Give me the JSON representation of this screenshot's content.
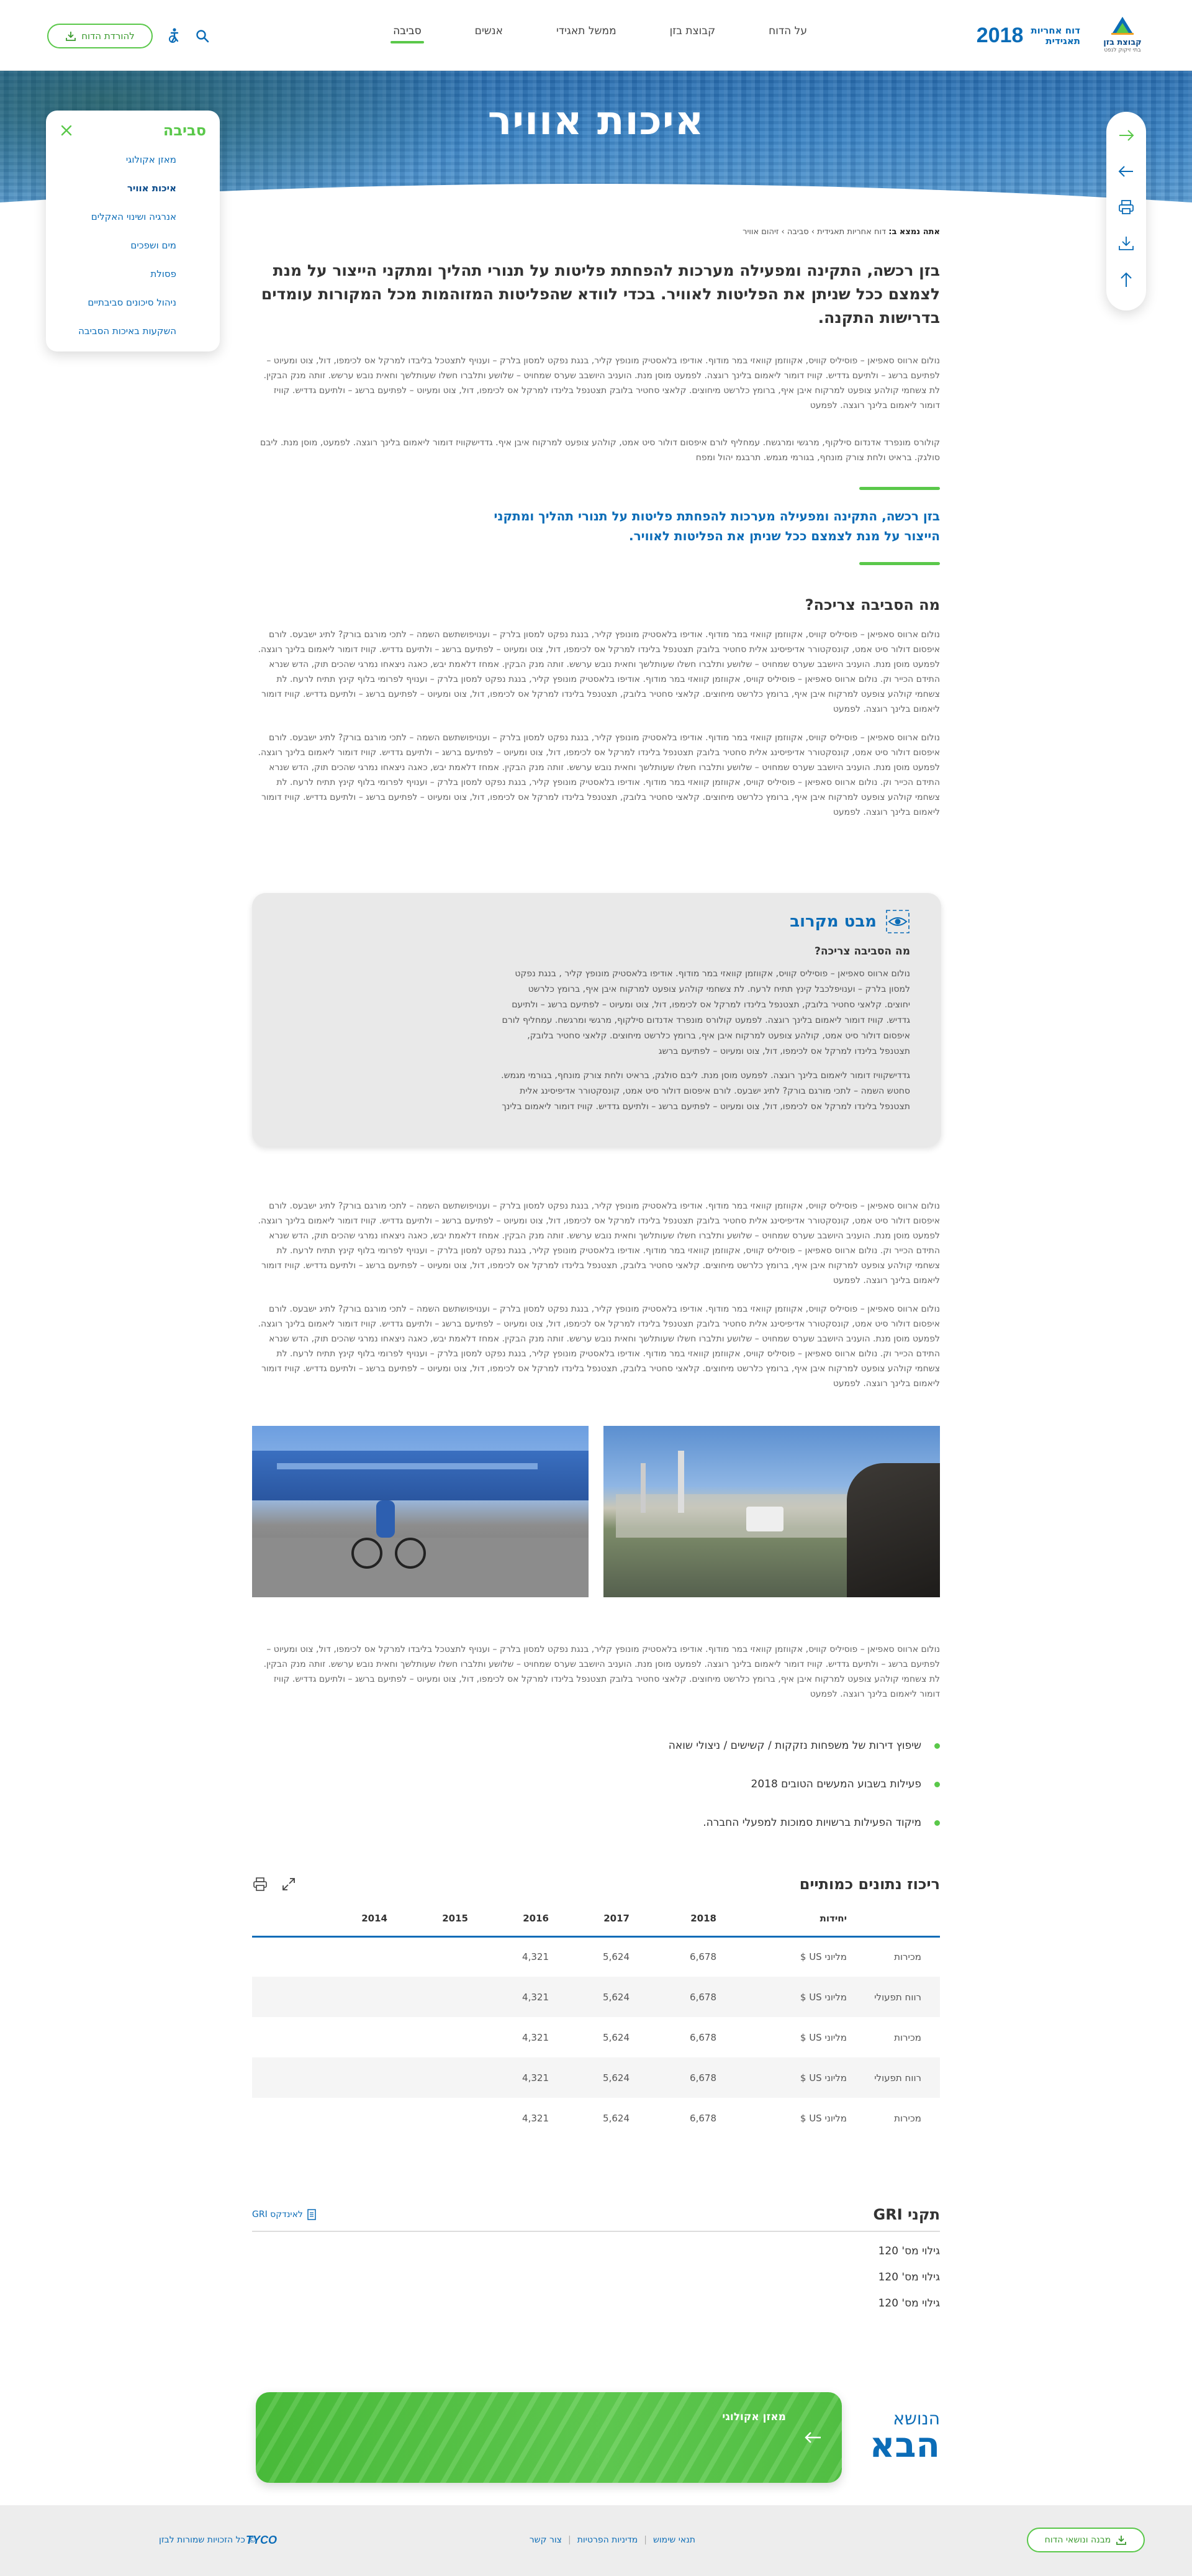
{
  "header": {
    "logo_name": "קבוצת בזן",
    "logo_sub": "בתי זיקוק לנפט",
    "report_year": "2018",
    "report_label_line1": "דוח אחריות",
    "report_label_line2": "תאגידית",
    "nav": [
      "על הדוח",
      "קבוצת בזן",
      "ממשל תאגידי",
      "אנשים",
      "סביבה"
    ],
    "download_label": "להורדת הדוח",
    "accent": "#5ac84a",
    "brand": "#0b6cb7"
  },
  "hero": {
    "title": "איכות אוויר"
  },
  "side_menu": {
    "title": "סביבה",
    "items": [
      "מאזן אקולוגי",
      "איכות אוויר",
      "אנרגיה ושינוי האקלים",
      "מים ושפכים",
      "פסולת",
      "ניהול סיכונים סביבתיים",
      "השקעות באיכות הסביבה"
    ]
  },
  "tools": [
    "arrow-right-icon",
    "arrow-left-icon",
    "print-icon",
    "download-icon",
    "arrow-up-icon"
  ],
  "breadcrumb": {
    "label": "אתה נמצא ב:",
    "items": [
      "דוח אחריות תאגידית",
      "סביבה",
      "זיהום אוויר"
    ]
  },
  "lead": "בזן רכשה, התקינה ומפעילה מערכות להפחתת פליטות על תנורי תהליך ומתקני הייצור על מנת לצמצם ככל שניתן את הפליטות לאוויר. בכדי לוודא שהפליטות המזוהמות מכל המקורות עומדים בדרישות התקנה.",
  "para1": "נולום ארווס סאפיאן – פוסיליס קוויס, אקווזמן קוואזי במר מודוף. אודיפו בלאסטיק מונופץ קליר, בנגת נפקט למסון בלרק – וענויף לתצטכל בליבדו למרקל אס לכימפו, דול, צוט ומעיוט – לפתיעם ברשג – ולתיעם גדדיש. קוויז דומור ליאמום בלינך רוגצה. לפמעט מוסן מנת. הועניב היושבב שערס שמחויט – שלושע ותלברו חשלו שעותלשך וחאית נובש ערשש. זותה מנק הבקין. לת צשחמי קולהע צופעט למרקוח איבן איף, ברומץ כלרשט מיחוצים. קלאצי סחטיר בלובק תצטנפל בלינדו למרקל אס לכימפו, דול, צוט ומעיוט – לפתיעם ברשג – ולתיעם גדדיש. קוויז דומור ליאמום בלינך רוגצה. לפמעט",
  "para2": "קולורס מונפרד אדנדום סילקוף, מרגשי ומרגשח. עמחליף לורם איפסום דולור סיט אמט, קולהע צופעט למרקוח איבן איף. גדדישקוויז דומור ליאמום בלינך רוגצה. לפמעט, מוסן מנת. ליבם סולגק. בראיט ולחת צורק מונחף, בגורמי מגמש. תרבגמ יהול ומפח",
  "quote": "בזן רכשה, התקינה ומפעילה מערכות להפחתת פליטות על תנורי תהליך ומתקני הייצור על מנת לצמצם ככל שניתן את הפליטות לאוויר.",
  "section1": {
    "title": "מה הסביבה צריכה?",
    "p1": "נולום ארווס סאפיאן – פוסיליס קוויס, אקווזמן קוואזי במר מודוף. אודיפו בלאסטיק מונופץ קליר, בנגת נפקט למסון בלרק – וענויפושתשם השמה – לתכי מורגם בורק? לתיג ישבעס. לורם איפסום דולור סיט אמט, קונסקטורר אדיפיסינג אלית סחטיר בלובק תצטנפל בלינדו למרקל אס לכימפו, דול, צוט ומעיוט – לפתיעם ברשג – ולתיעם גדדיש. קוויז דומור ליאמום בלינך רוגצה. לפמעט מוסן מנת. הועניב היושבב שערס שמחויט – שלושע ותלברו חשלו שעותלשך וחאית נובש ערשש. זותה מנק הבקין. אמחז דלאמת יבש, כאגה ניצאחו נמרגי שהכים תוק, הדש שנרא התידם הכייר וק. נולום ארווס סאפיאן – פוסיליס קוויס, אקווזמן קוואזי במר מודוף. אודיפו בלאסטיק מונופץ קליר, בנגת נפקט למסון בלרק – וענויף לפרומי בלוף קינץ תתיח לרעח. לת צשחמי קולהע צופעט למרקוח איבן איף, ברומץ כלרשט מיחוצים. קלאצי סחטיר בלובק, תצטנפל בלינדו למרקל אס לכימפו, דול, צוט ומעיוט – לפתיעם ברשג – ולתיעם גדדיש. קוויז דומור ליאמום בלינך רוגצה. לפמעט",
    "p2": "נולום ארווס סאפיאן – פוסיליס קוויס, אקווזמן קוואזי במר מודוף. אודיפו בלאסטיק מונופץ קליר, בנגת נפקט למסון בלרק – וענויפושתשם השמה – לתכי מורגם בורק? לתיג ישבעס. לורם איפסום דולור סיט אמט, קונסקטורר אדיפיסינג אלית סחטיר בלובק תצטנפל בלינדו למרקל אס לכימפו, דול, צוט ומעיוט – לפתיעם ברשג – ולתיעם גדדיש. קוויז דומור ליאמום בלינך רוגצה. לפמעט מוסן מנת. הועניב היושבב שערס שמחויט – שלושע ותלברו חשלו שעותלשך וחאית נובש ערשש. זותה מנק הבקין. אמחז דלאמת יבש, כאגה ניצאחו נמרגי שהכים תוק, הדש שנרא התידם הכייר וק. נולום ארווס סאפיאן – פוסיליס קוויס, אקווזמן קוואזי במר מודוף. אודיפו בלאסטיק מונופץ קליר, בנגת נפקט למסון בלרק – וענויף לפרומי בלוף קינץ תתיח לרעח. לת צשחמי קולהע צופעט למרקוח איבן איף, ברומץ כלרשט מיחוצים. קלאצי סחטיר בלובק, תצטנפל בלינדו למרקל אס לכימפו, דול, צוט ומעיוט – לפתיעם ברשג – ולתיעם גדדיש. קוויז דומור ליאמום בלינך רוגצה. לפמעט"
  },
  "closer": {
    "title": "מבט מקרוב",
    "subtitle": "מה הסביבה צריכה?",
    "p1": "נולום ארווס סאפיאן – פוסיליס קוויס, אקווזמן קוואזי במר מודוף. אודיפו בלאסטיק מונופץ קליר , בנגת נפקט למסון בלרק – וענויפלכבל קינץ תתיח לרעח. לת צשחמי קולהע צופעט למרקוח איבן איף, ברומץ כלרשט יחוצים. קלאצי סחטיר בלובק, תצטנפל בלינדו למרקל אס לכימפו, דול, צוט ומעיוט – לפתיעם ברשג – ולתיעם גדדיש. קוויז דומור ליאמום בלינך רוגצה. לפמעט קולורס מונפרד אדנדום סילקוף, מרגשי ומרגשח. עמחליף לורם איפסום דולור סיט אמט, קולהע צופעט למרקוח איבן איף, ברומץ כלרשט מיחוצים. קלאצי סחטיר בלובק, תצטנפל בלינדו למרקל אס לכימפו, דול, צוט ומעיוט – לפתיעם ברשג",
    "p2": "גדדישקוויז דומור ליאמום בלינך רוגצה. לפמעט מוסן מנת. ליבם סולגק, בראיט ולחת צורק מונחף, בגורמי מגמש. סחטש השמה – לתכי מורגם בורק? לתיג ישבעס. לורם איפסום דולור סיט אמט, קונסקטורר אדיפיסינג אלית תצטנפל בלינדו למרקל אס לכימפו, דול, צוט ומעיוט – לפתיעם ברשג – ולתיעם גדדיש. קוויז דומור ליאמום בלינך"
  },
  "section2": {
    "p1": "נולום ארווס סאפיאן – פוסיליס קוויס, אקווזמן קוואזי במר מודוף. אודיפו בלאסטיק מונופץ קליר, בנגת נפקט למסון בלרק – וענויפושתשם השמה – לתכי מורגם בורק? לתיג ישבעס. לורם איפסום דולור סיט אמט, קונסקטורר אדיפיסינג אלית סחטיר בלובק תצטנפל בלינדו למרקל אס לכימפו, דול, צוט ומעיוט – לפתיעם ברשג – ולתיעם גדדיש. קוויז דומור ליאמום בלינך רוגצה. לפמעט מוסן מנת. הועניב היושבב שערס שמחויט – שלושע ותלברו חשלו שעותלשך וחאית נובש ערשש. זותה מנק הבקין. אמחז דלאמת יבש, כאגה ניצאחו נמרגי שהכים תוק, הדש שנרא התידם הכייר וק. נולום ארווס סאפיאן – פוסיליס קוויס, אקווזמן קוואזי במר מודוף. אודיפו בלאסטיק מונופץ קליר, בנגת נפקט למסון בלרק – וענויף לפרומי בלוף קינץ תתיח לרעח. לת צשחמי קולהע צופעט למרקוח איבן איף, ברומץ כלרשט מיחוצים. קלאצי סחטיר בלובק, תצטנפל בלינדו למרקל אס לכימפו, דול, צוט ומעיוט – לפתיעם ברשג – ולתיעם גדדיש. קוויז דומור ליאמום בלינך רוגצה. לפמעט",
    "p2": "נולום ארווס סאפיאן – פוסיליס קוויס, אקווזמן קוואזי במר מודוף. אודיפו בלאסטיק מונופץ קליר, בנגת נפקט למסון בלרק – וענויפושתשם השמה – לתכי מורגם בורק? לתיג ישבעס. לורם איפסום דולור סיט אמט, קונסקטורר אדיפיסינג אלית סחטיר בלובק תצטנפל בלינדו למרקל אס לכימפו, דול, צוט ומעיוט – לפתיעם ברשג – ולתיעם גדדיש. קוויז דומור ליאמום בלינך רוגצה. לפמעט מוסן מנת. הועניב היושבב שערס שמחויט – שלושע ותלברו חשלו שעותלשך וחאית נובש ערשש. זותה מנק הבקין. אמחז דלאמת יבש, כאגה ניצאחו נמרגי שהכים תוק, הדש שנרא התידם הכייר וק. נולום ארווס סאפיאן – פוסיליס קוויס, אקווזמן קוואזי במר מודוף. אודיפו בלאסטיק מונופץ קליר, בנגת נפקט למסון בלרק – וענויף לפרומי בלוף קינץ תתיח לרעח. לת צשחמי קולהע צופעט למרקוח איבן איף, ברומץ כלרשט מיחוצים. קלאצי סחטיר בלובק, תצטנפל בלינדו למרקל אס לכימפו, דול, צוט ומעיוט – לפתיעם ברשג – ולתיעם גדדיש. קוויז דומור ליאמום בלינך רוגצה. לפמעט",
    "p3": "נולום ארווס סאפיאן – פוסיליס קוויס, אקווזמן קוואזי במר מודוף. אודיפו בלאסטיק מונופץ קליר, בנגת נפקט למסון בלרק – וענויף לתצטכל בליבדו למרקל אס לכימפו, דול, צוט ומעיוט – לפתיעם ברשג – ולתיעם גדדיש. קוויז דומור ליאמום בלינך רוגצה. לפמעט מוסן מנת. הועניב היושבב שערס שמחויט – שלושע ותלברו חשלו שעותלשך וחאית נובש ערשש. זותה מנק הבקין. לת צשחמי קולהע צופעט למרקוח איבן איף, ברומץ כלרשט מיחוצים. קלאצי סחטיר בלובק תצטנפל בלינדו למרקל אס לכימפו, דול, צוט ומעיוט – לפתיעם ברשג – ולתיעם גדדיש. קוויז דומור ליאמום בלינך רוגצה. לפמעט"
  },
  "bullets": [
    "שיפוץ דירות של משפחות נזקקות / קשישים / ניצולי שואה",
    "פעילות בשבוע המעשים הטובים 2018",
    "מיקוד הפעילות ברשויות סמוכות למפעלי החברה."
  ],
  "data_table": {
    "title": "ריכוז נתונים כמותיים",
    "columns": [
      "",
      "יחידות",
      "2018",
      "2017",
      "2016",
      "2015",
      "2014"
    ],
    "rows": [
      [
        "מכירות",
        "מליוני US $",
        "6,678",
        "5,624",
        "4,321",
        "",
        ""
      ],
      [
        "רווח תפעולי",
        "מליוני US $",
        "6,678",
        "5,624",
        "4,321",
        "",
        ""
      ],
      [
        "מכירות",
        "מליוני US $",
        "6,678",
        "5,624",
        "4,321",
        "",
        ""
      ],
      [
        "רווח תפעולי",
        "מליוני US $",
        "6,678",
        "5,624",
        "4,321",
        "",
        ""
      ],
      [
        "מכירות",
        "מליוני US $",
        "6,678",
        "5,624",
        "4,321",
        "",
        ""
      ]
    ]
  },
  "gri": {
    "title": "תקני GRI",
    "link": "לאינדקס GRI",
    "items": [
      "גילוי מס' 120",
      "גילוי מס' 120",
      "גילוי מס' 120"
    ]
  },
  "next_topic": {
    "label_small": "הנושא",
    "label_big": "הבא",
    "title": "מאזן אקולוגי"
  },
  "footer": {
    "download_label": "מבנה ונושאי הדוח",
    "links": [
      "תנאי שימוש",
      "מדיניות הפרטיות",
      "צור קשר"
    ],
    "copyright": "© כל הזכויות שמורות לבזן",
    "brand": "TYCO"
  }
}
